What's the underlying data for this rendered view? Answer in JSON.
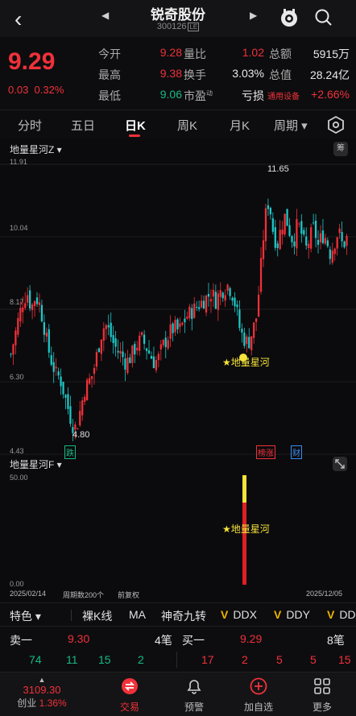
{
  "header": {
    "title": "锐奇股份",
    "code": "300126",
    "code_mark": "LE"
  },
  "quote": {
    "price": "9.29",
    "change": "0.03",
    "change_pct": "0.32%",
    "rows": [
      {
        "l1": "今开",
        "v1": "9.28",
        "l2": "量比",
        "v2": "1.02",
        "l3": "总额",
        "v3": "5915万"
      },
      {
        "l1": "最高",
        "v1": "9.38",
        "l2": "换手",
        "v2": "3.03%",
        "l3": "总值",
        "v3": "28.24亿"
      },
      {
        "l1": "最低",
        "v1": "9.06",
        "l2": "市盈",
        "l2sup": "动",
        "v2": "亏损",
        "l3": "通用设备",
        "v3": "+2.66%"
      }
    ]
  },
  "tabs": [
    "分时",
    "五日",
    "日K",
    "周K",
    "月K",
    "周期"
  ],
  "active_tab": "日K",
  "chart": {
    "indicator_main": "地量星河Z",
    "indicator_sub": "地量星河F",
    "strategy_badge": "筹",
    "y_ticks": [
      "11.91",
      "10.04",
      "8.17",
      "6.30",
      "4.43"
    ],
    "high_label": "11.65",
    "low_label": "4.80",
    "signal_label": "★地量星河",
    "sub_signal_label": "★地量星河",
    "markers": {
      "die": "跌",
      "bangzhang": "榜涨",
      "cai": "财"
    },
    "sub_y_top": "50.00",
    "sub_y_bottom": "0.00",
    "start_date": "2025/02/14",
    "period_info": "周期数200个",
    "adjust": "前复权",
    "end_date": "2025/12/05"
  },
  "chart_data": {
    "type": "candlestick",
    "ylim": [
      4.43,
      11.91
    ],
    "high": 11.65,
    "low": 4.8,
    "start": "2025/02/14",
    "end": "2025/12/05",
    "count": 200,
    "close_path": [
      7.0,
      7.5,
      8.0,
      8.4,
      8.6,
      8.2,
      8.5,
      8.3,
      7.8,
      7.2,
      6.8,
      6.5,
      6.4,
      6.0,
      5.6,
      5.2,
      5.1,
      5.6,
      6.1,
      6.3,
      6.5,
      7.0,
      7.5,
      7.8,
      7.6,
      7.3,
      7.1,
      7.0,
      6.8,
      6.9,
      7.1,
      7.3,
      7.4,
      7.2,
      7.0,
      6.8,
      6.9,
      7.2,
      7.4,
      7.6,
      7.7,
      7.6,
      7.8,
      8.0,
      8.1,
      8.2,
      8.3,
      8.4,
      8.5,
      8.6,
      8.4,
      8.6,
      8.7,
      8.8,
      8.6,
      8.2,
      7.6,
      7.4,
      7.3,
      7.6,
      8.0,
      9.2,
      10.5,
      11.0,
      10.2,
      9.8,
      10.3,
      10.6,
      10.2,
      9.9,
      10.4,
      10.1,
      9.7,
      10.0,
      10.3,
      9.8,
      10.1,
      10.0,
      9.6,
      9.9,
      10.2,
      9.8,
      10.0
    ],
    "sub_signal": 50
  },
  "indicators": {
    "selector": "特色",
    "items": [
      "裸K线",
      "MA",
      "神奇九转",
      "DDX",
      "DDY",
      "DD"
    ]
  },
  "orderbook": {
    "sell_label": "卖一",
    "sell_price": "9.30",
    "sell_vol": "4笔",
    "buy_label": "买一",
    "buy_price": "9.29",
    "buy_vol": "8笔",
    "sell_queue": [
      "74",
      "11",
      "15",
      "2"
    ],
    "buy_queue": [
      "17",
      "2",
      "5",
      "5",
      "15"
    ]
  },
  "nav": {
    "index_value": "3109.30",
    "index_name": "创业",
    "index_pct": "1.36%",
    "items": [
      "交易",
      "预警",
      "加自选",
      "更多"
    ]
  }
}
